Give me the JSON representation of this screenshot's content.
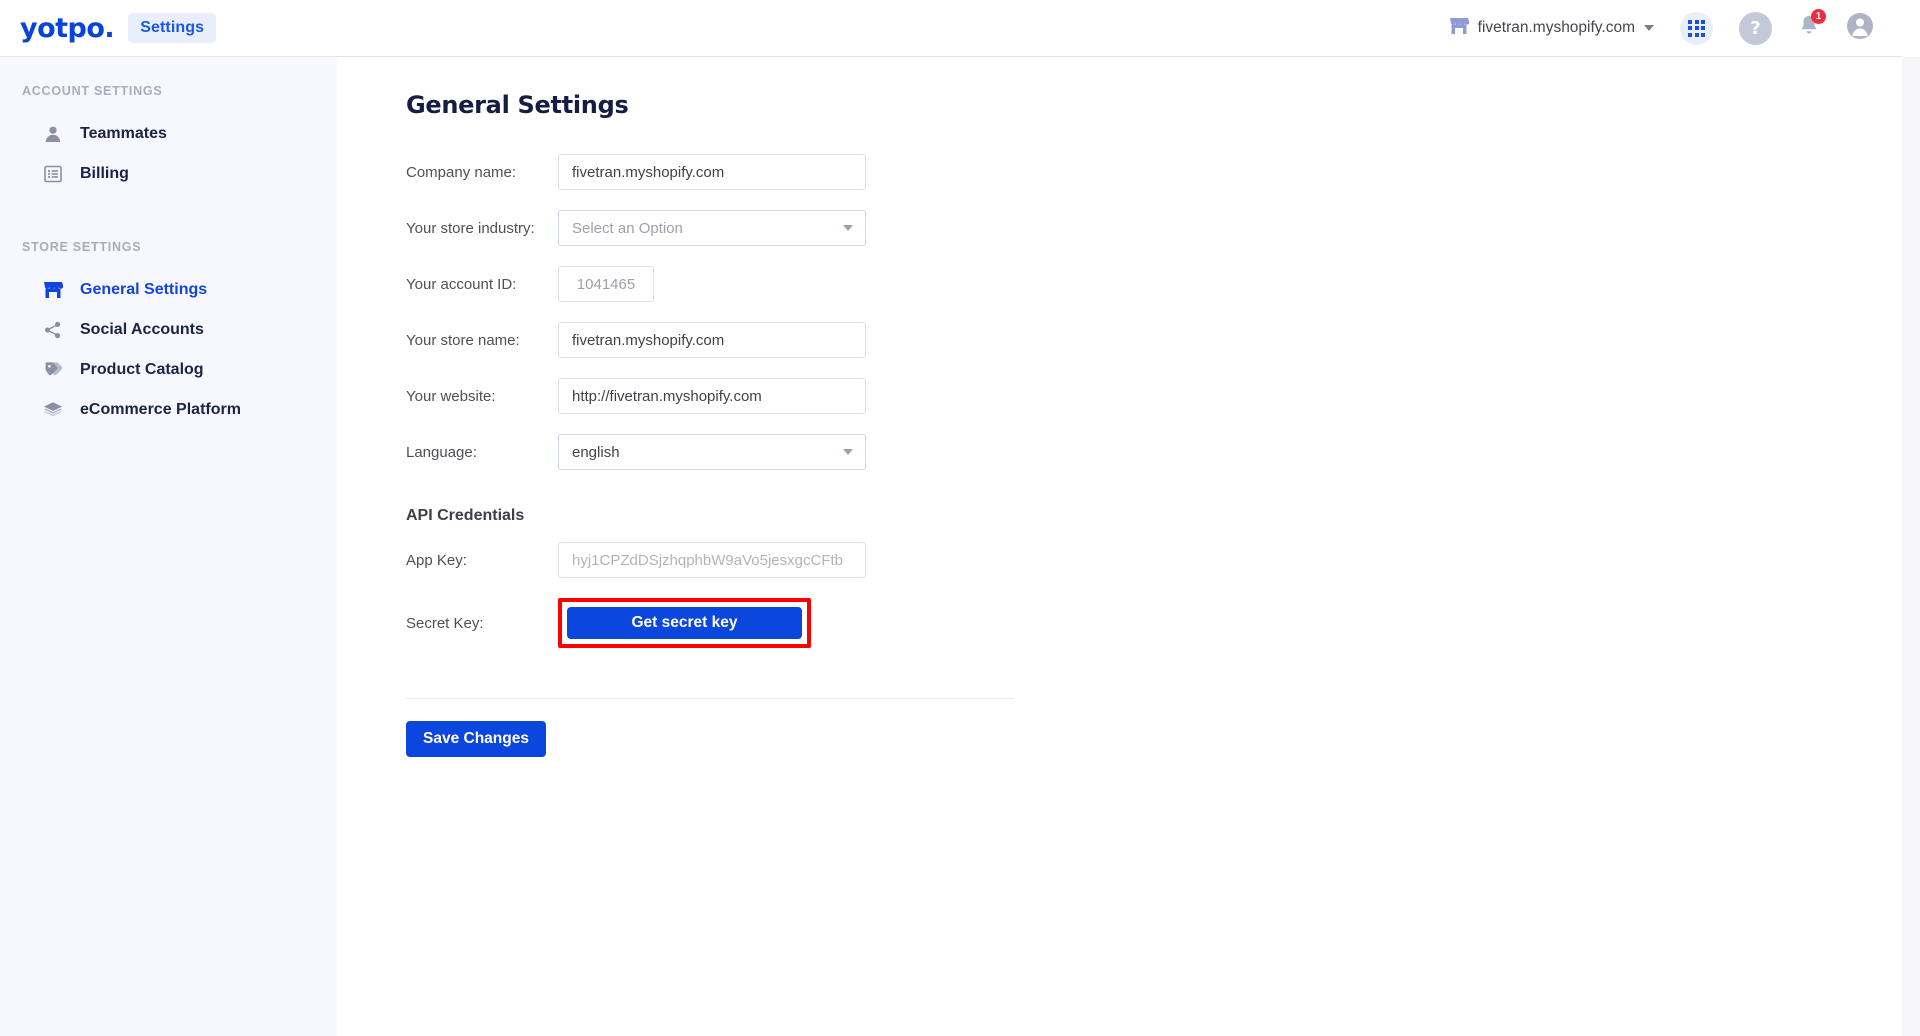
{
  "header": {
    "logo": "yotpo.",
    "section_badge": "Settings",
    "store_name": "fivetran.myshopify.com",
    "icons": {
      "store": "storefront-icon",
      "caret": "chevron-down-icon",
      "apps": "apps-grid-icon",
      "help": "?",
      "bell": "notifications-bell-icon",
      "bell_badge": "1",
      "avatar": "user-avatar-icon"
    }
  },
  "sidebar": {
    "groups": [
      {
        "title": "ACCOUNT SETTINGS",
        "items": [
          {
            "label": "Teammates",
            "icon": "person-icon",
            "active": false
          },
          {
            "label": "Billing",
            "icon": "list-document-icon",
            "active": false
          }
        ]
      },
      {
        "title": "STORE SETTINGS",
        "items": [
          {
            "label": "General Settings",
            "icon": "storefront-icon",
            "active": true
          },
          {
            "label": "Social Accounts",
            "icon": "share-nodes-icon",
            "active": false
          },
          {
            "label": "Product Catalog",
            "icon": "price-tag-icon",
            "active": false
          },
          {
            "label": "eCommerce Platform",
            "icon": "layers-stack-icon",
            "active": false
          }
        ]
      }
    ]
  },
  "main": {
    "page_title": "General Settings",
    "fields": {
      "company_name": {
        "label": "Company name:",
        "value": "fivetran.myshopify.com"
      },
      "store_industry": {
        "label": "Your store industry:",
        "placeholder": "Select an Option",
        "value": ""
      },
      "account_id": {
        "label": "Your account ID:",
        "value": "1041465"
      },
      "store_name": {
        "label": "Your store name:",
        "value": "fivetran.myshopify.com"
      },
      "website": {
        "label": "Your website:",
        "value": "http://fivetran.myshopify.com"
      },
      "language": {
        "label": "Language:",
        "value": "english"
      }
    },
    "api_section": {
      "heading": "API Credentials",
      "app_key": {
        "label": "App Key:",
        "value": "hyj1CPZdDSjzhqphbW9aVo5jesxgcCFtb"
      },
      "secret_key": {
        "label": "Secret Key:",
        "button": "Get secret key"
      }
    },
    "save_button": "Save Changes"
  },
  "colors": {
    "brand_blue": "#0a43d9",
    "primary_button": "#0b46dd",
    "active_nav": "#1344dd",
    "badge_bg": "#e8eefb",
    "sidebar_bg": "#f7f8fd",
    "highlight_red": "#ff0000",
    "notification_red": "#f22c3d"
  }
}
